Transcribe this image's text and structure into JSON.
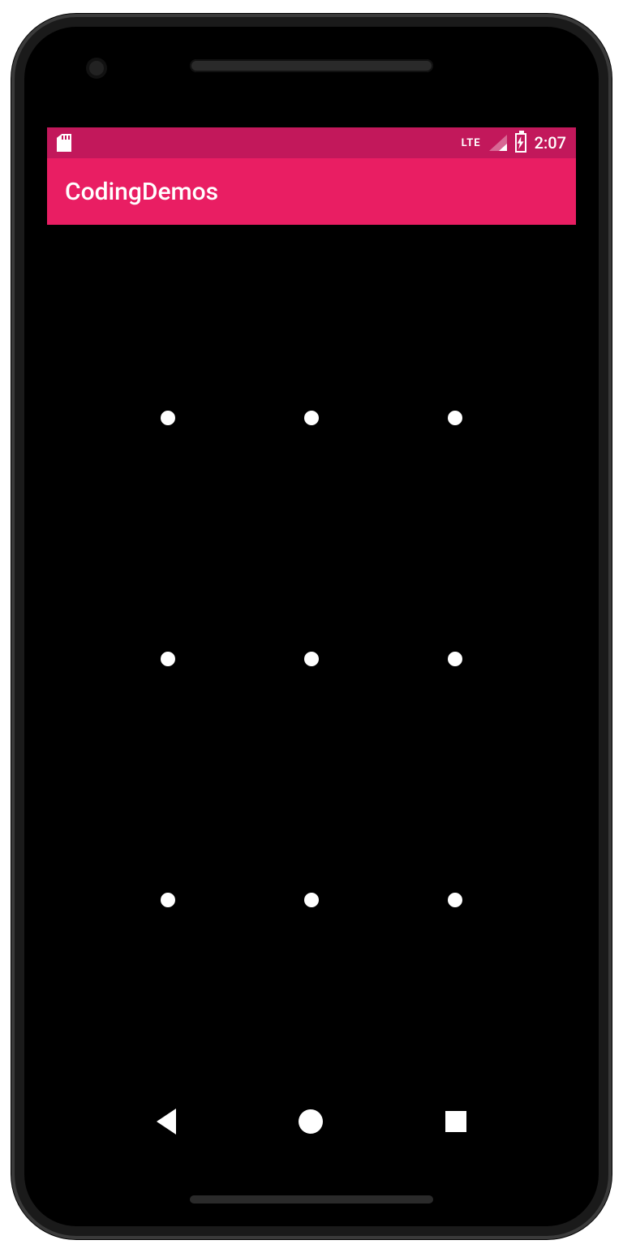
{
  "status": {
    "network_type": "LTE",
    "clock": "2:07"
  },
  "app_bar": {
    "title": "CodingDemos"
  },
  "colors": {
    "primary": "#e91e63",
    "primary_dark": "#c2185b",
    "background": "#000000",
    "on_primary": "#ffffff"
  },
  "pattern_lock": {
    "rows": 3,
    "cols": 3,
    "dot_count": 9
  },
  "nav": {
    "back": "back",
    "home": "home",
    "recent": "recent"
  },
  "icons": {
    "sd_card": "sd-card-icon",
    "signal": "signal-icon",
    "battery_charging": "battery-charging-icon"
  }
}
